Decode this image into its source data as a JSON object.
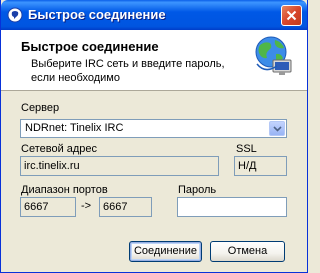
{
  "window": {
    "title": "Быстрое соединение"
  },
  "header": {
    "title": "Быстрое соединение",
    "description": "Выберите IRC сеть и введите пароль, если необходимо"
  },
  "server": {
    "label": "Сервер",
    "selected": "NDRnet: Tinelix IRC"
  },
  "address": {
    "label": "Сетевой адрес",
    "value": "irc.tinelix.ru"
  },
  "ssl": {
    "label": "SSL",
    "value": "Н/Д"
  },
  "ports": {
    "label": "Диапазон портов",
    "from": "6667",
    "arrow": "->",
    "to": "6667"
  },
  "password": {
    "label": "Пароль",
    "value": ""
  },
  "buttons": {
    "connect": "Соединение",
    "cancel": "Отмена"
  },
  "icons": {
    "title": "irc-chat-icon",
    "header": "globe-network-icon",
    "close": "close-icon",
    "dropdown": "chevron-down-icon"
  },
  "colors": {
    "titlebar": "#0058E6",
    "accent": "#0831D9",
    "dialog_bg": "#ECE9D8"
  }
}
